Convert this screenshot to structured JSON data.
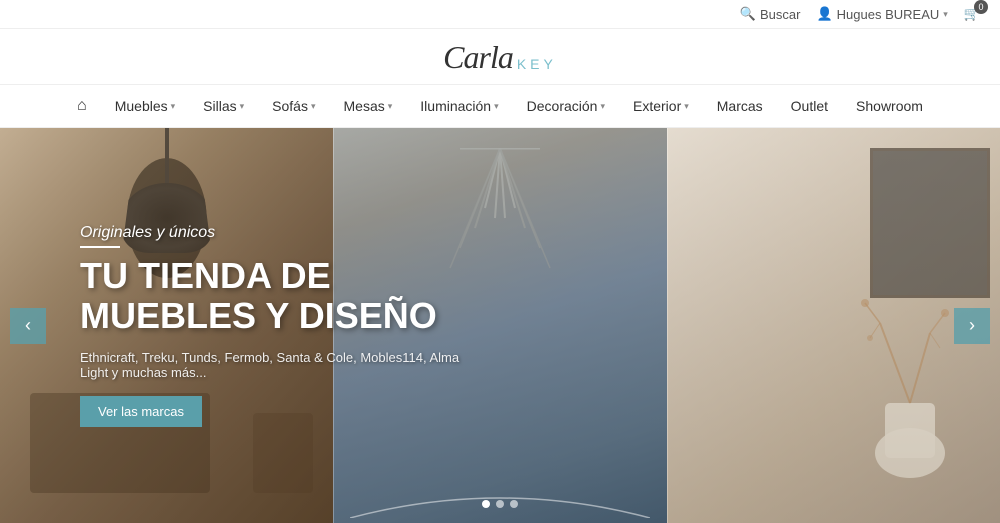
{
  "topbar": {
    "search_label": "Buscar",
    "user_label": "Hugues BUREAU",
    "cart_count": "0"
  },
  "logo": {
    "brand": "Carla",
    "key": "KEY"
  },
  "nav": {
    "home_label": "Home",
    "items": [
      {
        "label": "Muebles",
        "has_dropdown": true
      },
      {
        "label": "Sillas",
        "has_dropdown": true
      },
      {
        "label": "Sofás",
        "has_dropdown": true
      },
      {
        "label": "Mesas",
        "has_dropdown": true
      },
      {
        "label": "Iluminación",
        "has_dropdown": true
      },
      {
        "label": "Decoración",
        "has_dropdown": true
      },
      {
        "label": "Exterior",
        "has_dropdown": true
      },
      {
        "label": "Marcas",
        "has_dropdown": false
      },
      {
        "label": "Outlet",
        "has_dropdown": false
      },
      {
        "label": "Showroom",
        "has_dropdown": false
      }
    ]
  },
  "hero": {
    "subtitle": "Originales y únicos",
    "title": "TU TIENDA DE MUEBLES Y DISEÑO",
    "brands_text": "Ethnicraft, Treku, Tunds, Fermob, Santa & Cole, Mobles114, Alma Light y muchas más...",
    "cta_label": "Ver las marcas",
    "arrow_left": "‹",
    "arrow_right": "›",
    "dots": [
      true,
      false,
      false
    ]
  }
}
